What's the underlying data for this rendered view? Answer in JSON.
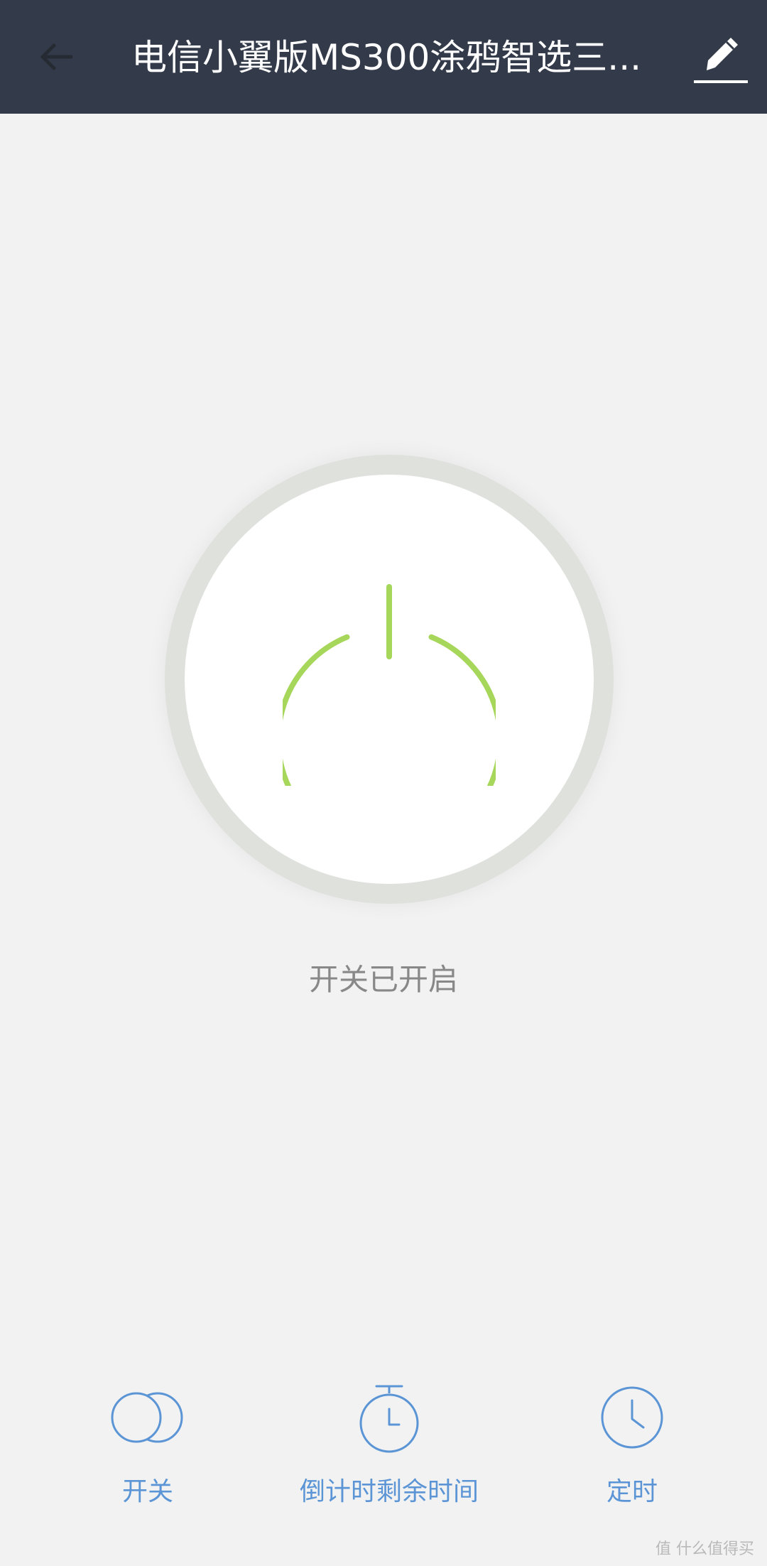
{
  "header": {
    "title": "电信小翼版MS300涂鸦智选三...",
    "back_icon": "arrow-left-icon",
    "edit_icon": "pencil-icon"
  },
  "power": {
    "state": "on",
    "status_text": "开关已开启",
    "icon": "power-icon",
    "color": "#a6d65a"
  },
  "actions": [
    {
      "label": "开关",
      "icon": "toggle-circles-icon"
    },
    {
      "label": "倒计时剩余时间",
      "icon": "stopwatch-icon"
    },
    {
      "label": "定时",
      "icon": "clock-icon"
    }
  ],
  "watermark": "值 什么值得买",
  "colors": {
    "header_bg": "#333a49",
    "accent_blue": "#5b95d6",
    "page_bg": "#f2f2f2"
  }
}
